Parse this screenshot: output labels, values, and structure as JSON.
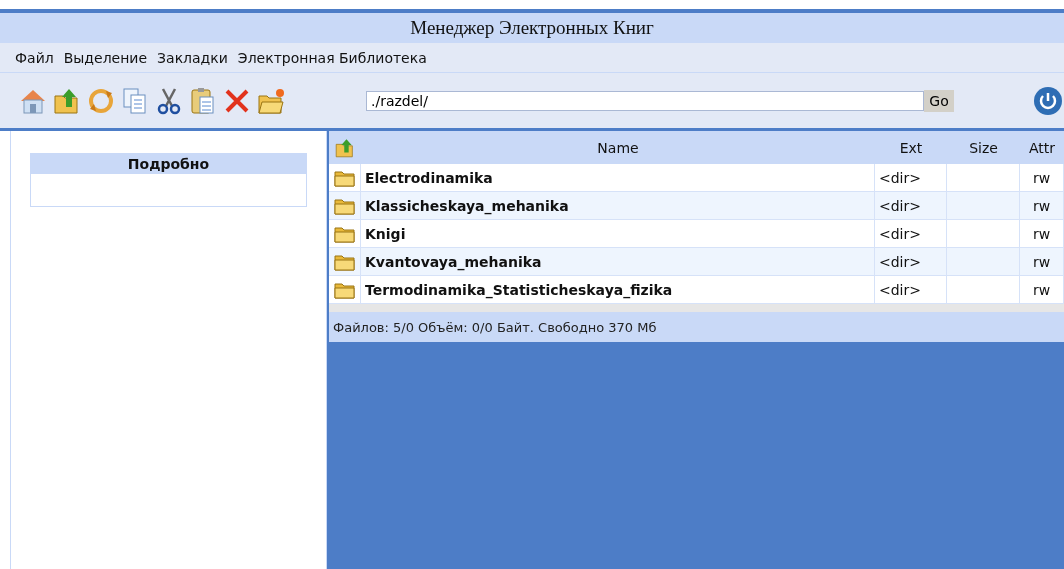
{
  "window": {
    "title": "Менеджер Электронных Книг"
  },
  "menu": [
    "Файл",
    "Выделение",
    "Закладки",
    "Электронная Библиотека"
  ],
  "toolbar": {
    "tools": [
      {
        "kind": "home"
      },
      {
        "kind": "up"
      },
      {
        "kind": "refresh"
      },
      {
        "kind": "copy"
      },
      {
        "kind": "cut"
      },
      {
        "kind": "paste"
      },
      {
        "kind": "delete"
      },
      {
        "kind": "newfolder"
      }
    ],
    "path": "./razdel/",
    "go": "Go"
  },
  "details": {
    "title": "Подробно"
  },
  "table": {
    "columns": [
      "Name",
      "Ext",
      "Size",
      "Attr"
    ],
    "rows": [
      {
        "name": "Electrodinamika",
        "ext": "<dir>",
        "attr": "rw"
      },
      {
        "name": "Klassicheskaya_mehanika",
        "ext": "<dir>",
        "attr": "rw"
      },
      {
        "name": "Knigi",
        "ext": "<dir>",
        "attr": "rw"
      },
      {
        "name": "Kvantovaya_mehanika",
        "ext": "<dir>",
        "attr": "rw"
      },
      {
        "name": "Termodinamika_Statisticheskaya_fizika",
        "ext": "<dir>",
        "attr": "rw"
      }
    ]
  },
  "status_bar": "Файлов: 5/0 Объём: 0/0 Байт. Свободно 370 Мб"
}
